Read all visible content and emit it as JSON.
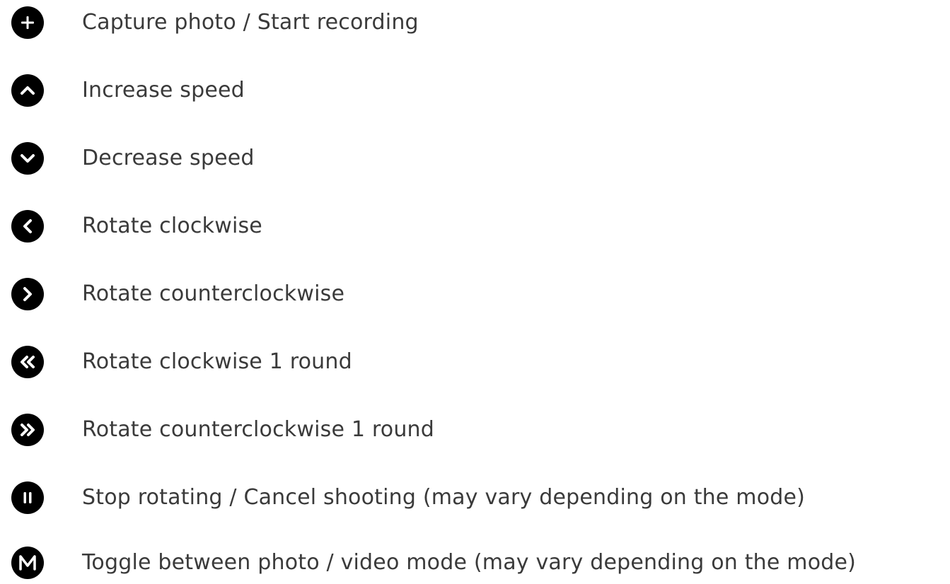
{
  "items": [
    {
      "icon": "plus-icon",
      "label": "Capture photo / Start recording"
    },
    {
      "icon": "chevron-up-icon",
      "label": "Increase speed"
    },
    {
      "icon": "chevron-down-icon",
      "label": "Decrease speed"
    },
    {
      "icon": "chevron-left-icon",
      "label": "Rotate clockwise"
    },
    {
      "icon": "chevron-right-icon",
      "label": "Rotate counterclockwise"
    },
    {
      "icon": "double-chevron-left-icon",
      "label": "Rotate clockwise 1 round"
    },
    {
      "icon": "double-chevron-right-icon",
      "label": "Rotate counterclockwise 1 round"
    },
    {
      "icon": "pause-icon",
      "label": "Stop rotating / Cancel shooting (may vary depending on the mode)"
    },
    {
      "icon": "m-letter-icon",
      "label": "Toggle between photo / video mode (may vary depending on the mode)"
    }
  ],
  "colors": {
    "icon_fill": "#000000",
    "icon_glyph": "#ffffff",
    "text": "#3a3a3a"
  }
}
